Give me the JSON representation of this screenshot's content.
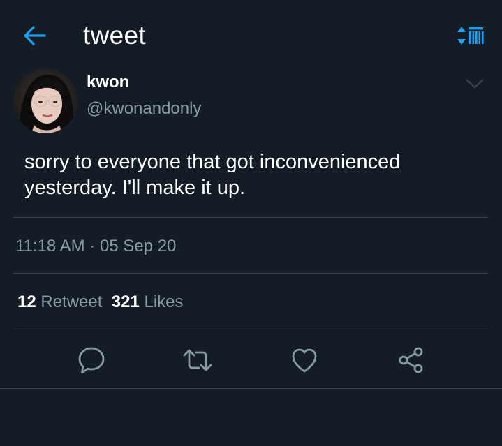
{
  "header": {
    "title": "tweet",
    "back_icon": "arrow-left-icon",
    "sort_icon": "sort-list-icon",
    "accent_color": "#1da1f2"
  },
  "author": {
    "name": "kwon",
    "handle": "@kwonandonly",
    "avatar_icon": "profile-photo"
  },
  "tweet": {
    "text": "sorry to everyone that got inconvenienced\nyesterday. I'll make it up.",
    "time": "11:18 AM",
    "separator": "·",
    "date": "05 Sep 20"
  },
  "stats": {
    "retweet_count": "12",
    "retweet_label": "Retweet",
    "like_count": "321",
    "like_label": "Likes"
  },
  "actions": [
    {
      "icon": "reply-icon"
    },
    {
      "icon": "retweet-icon"
    },
    {
      "icon": "like-icon"
    },
    {
      "icon": "share-icon"
    }
  ],
  "colors": {
    "background": "#141d26",
    "divider": "#38444d",
    "secondary_text": "#8899a6",
    "icon": "#8899a6"
  }
}
